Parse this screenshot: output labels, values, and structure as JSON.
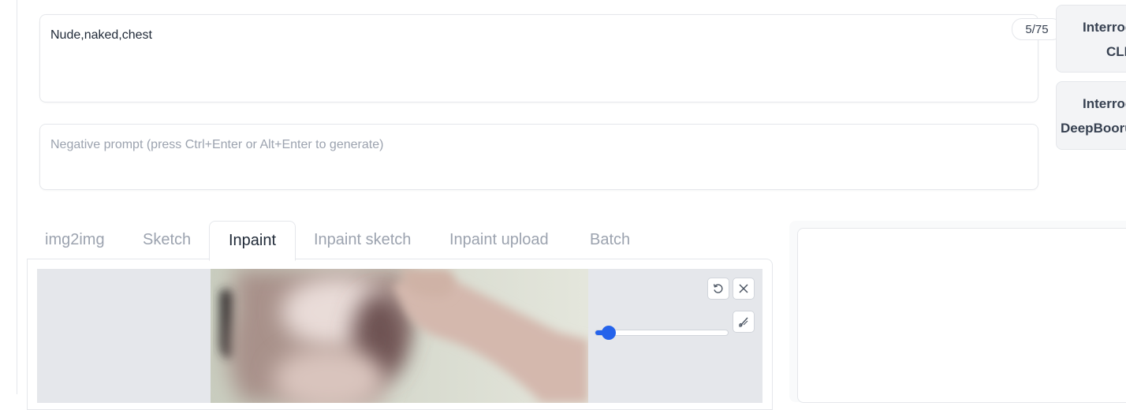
{
  "prompt": {
    "value": "Nude,naked,chest",
    "token_count": "5/75"
  },
  "negative_prompt": {
    "value": "",
    "placeholder": "Negative prompt (press Ctrl+Enter or Alt+Enter to generate)"
  },
  "side_buttons": [
    {
      "line1": "Interrogate",
      "line2": "CLIP"
    },
    {
      "line1": "Interrogate",
      "line2": "DeepBooru"
    }
  ],
  "tabs": [
    {
      "label": "img2img"
    },
    {
      "label": "Sketch"
    },
    {
      "label": "Inpaint",
      "selected": true
    },
    {
      "label": "Inpaint sketch"
    },
    {
      "label": "Inpaint upload"
    },
    {
      "label": "Batch"
    }
  ],
  "editor": {
    "brush_size_fraction": 0.1,
    "icons": [
      "undo-icon",
      "close-icon",
      "brush-icon"
    ]
  },
  "colors": {
    "accent": "#2563eb",
    "border": "#e5e7eb",
    "muted_text": "#9ca3af"
  }
}
